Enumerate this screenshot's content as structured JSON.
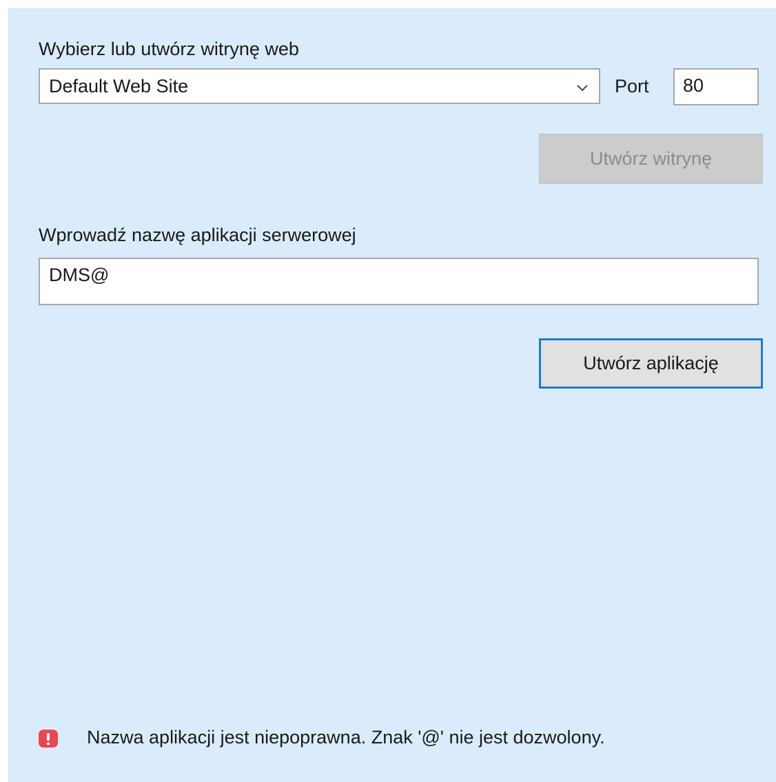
{
  "site": {
    "label": "Wybierz lub utwórz witrynę web",
    "selected": "Default Web Site",
    "dropdown_icon": "chevron-down-icon",
    "port_label": "Port",
    "port_value": "80",
    "create_site_button": "Utwórz witrynę"
  },
  "application": {
    "label": "Wprowadź nazwę aplikacji serwerowej",
    "name_value": "DMS@",
    "create_app_button": "Utwórz aplikację"
  },
  "status": {
    "icon": "error-icon",
    "message": "Nazwa aplikacji jest niepoprawna. Znak '@' nie jest dozwolony."
  },
  "colors": {
    "background": "#daecfb",
    "focus_border": "#1f7ad1",
    "disabled_button": "#cccccc",
    "error": "#e8474f"
  }
}
